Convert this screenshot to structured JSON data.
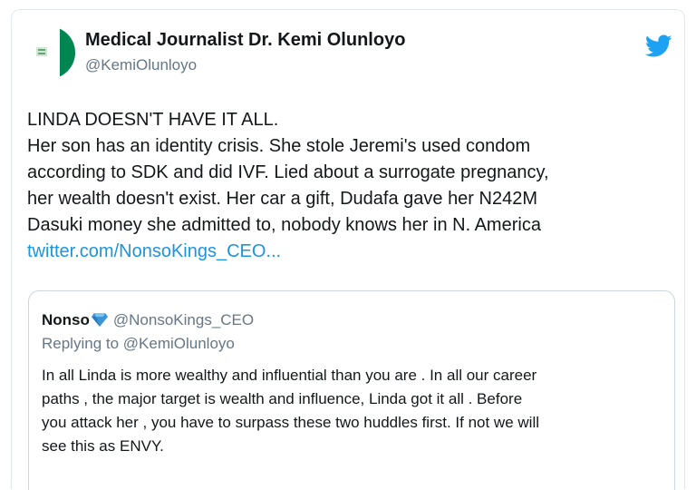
{
  "tweet": {
    "display_name": "Medical Journalist Dr. Kemi Olunloyo",
    "handle": "@KemiOlunloyo",
    "lines": [
      "LINDA DOESN'T HAVE IT ALL.",
      "Her son has an identity crisis. She stole Jeremi's used condom",
      "according to SDK and did IVF. Lied about a surrogate pregnancy,",
      "her wealth doesn't exist. Her car a gift, Dudafa gave her N242M",
      "Dasuki money she admitted to, nobody knows her in N. America"
    ],
    "link_text": "twitter.com/NonsoKings_CEO..."
  },
  "quoted": {
    "name": "Nonso",
    "handle": "@NonsoKings_CEO",
    "replying_to": "Replying to @KemiOlunloyo",
    "lines": [
      "In all Linda is more wealthy and influential than you are . In all our career",
      "paths , the major target is wealth and influence, Linda got it all . Before",
      "you attack her , you have to surpass these two huddles first. If not we will",
      "see this as ENVY."
    ]
  },
  "icons": {
    "avatar": "nigeria-flag-avatar-icon",
    "twitter": "twitter-bird-icon",
    "verified": "blue-diamond-icon"
  },
  "colors": {
    "twitter_blue": "#1da1f2",
    "link": "#1b95e0",
    "secondary_text": "#657786",
    "flag_green": "#008751"
  }
}
